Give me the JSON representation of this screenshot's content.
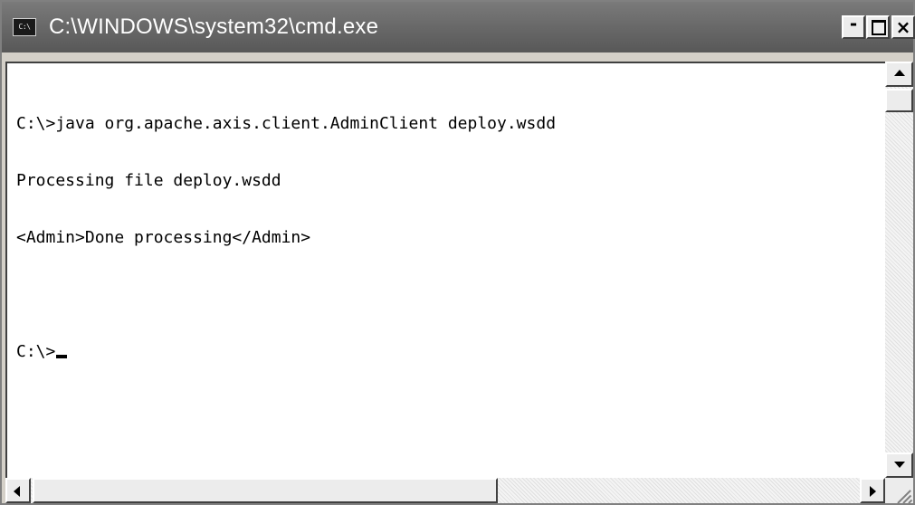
{
  "window": {
    "title": "C:\\WINDOWS\\system32\\cmd.exe",
    "icon": "cmd-prompt-icon",
    "icon_text": "C:\\"
  },
  "controls": {
    "minimize_icon": "minimize-icon",
    "minimize_label": "-",
    "maximize_icon": "maximize-icon",
    "close_icon": "close-icon",
    "close_label": "×"
  },
  "console": {
    "lines": [
      "C:\\>java org.apache.axis.client.AdminClient deploy.wsdd",
      "Processing file deploy.wsdd",
      "<Admin>Done processing</Admin>",
      "",
      "C:\\>"
    ],
    "colors": {
      "background": "#ffffff",
      "text": "#000000",
      "titlebar": "#6a6a6a"
    }
  }
}
